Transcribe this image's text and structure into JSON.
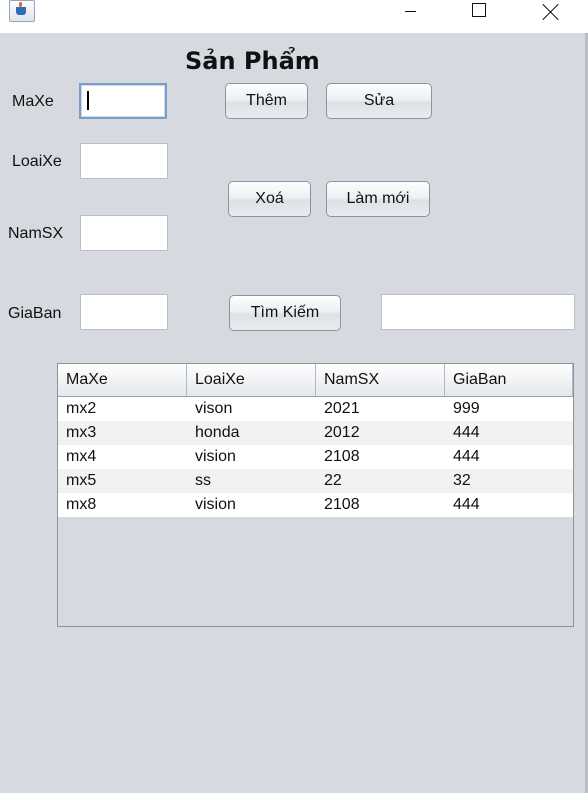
{
  "window": {
    "icon": "java-cup-icon"
  },
  "form": {
    "title": "Sản Phẩm",
    "fields": {
      "maxe": {
        "label": "MaXe",
        "value": ""
      },
      "loaixe": {
        "label": "LoaiXe",
        "value": ""
      },
      "namsx": {
        "label": "NamSX",
        "value": ""
      },
      "giaban": {
        "label": "GiaBan",
        "value": ""
      }
    },
    "search": {
      "value": ""
    }
  },
  "buttons": {
    "add": "Thêm",
    "edit": "Sửa",
    "delete": "Xoá",
    "refresh": "Làm mới",
    "search": "Tìm Kiếm"
  },
  "table": {
    "columns": [
      "MaXe",
      "LoaiXe",
      "NamSX",
      "GiaBan"
    ],
    "rows": [
      [
        "mx2",
        "vison",
        "2021",
        "999"
      ],
      [
        "mx3",
        "honda",
        "2012",
        "444"
      ],
      [
        "mx4",
        "vision",
        "2108",
        "444"
      ],
      [
        "mx5",
        "ss",
        "22",
        "32"
      ],
      [
        "mx8",
        "vision",
        "2108",
        "444"
      ]
    ]
  }
}
